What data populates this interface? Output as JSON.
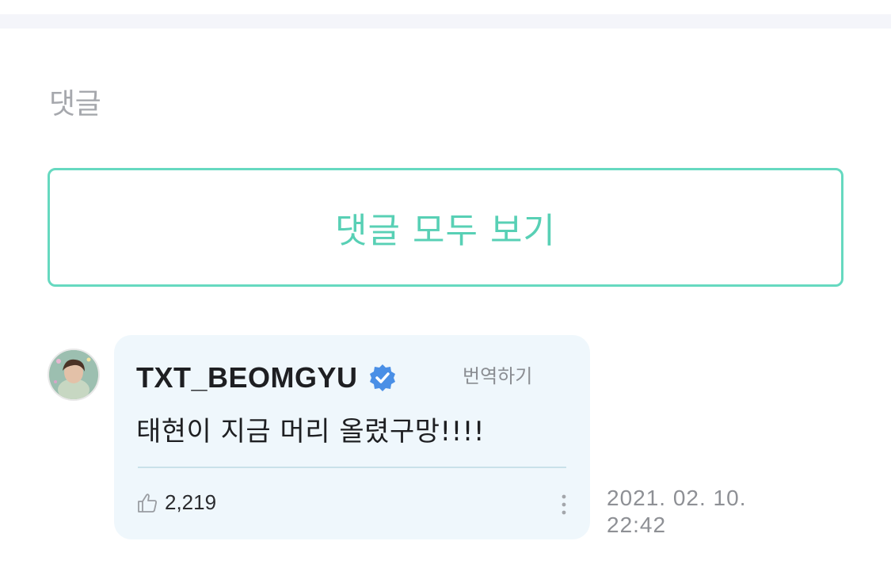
{
  "comments_section": {
    "title": "댓글",
    "view_all_label": "댓글 모두 보기"
  },
  "comment": {
    "author": "TXT_BEOMGYU",
    "verified": true,
    "translate_label": "번역하기",
    "text": "태현이 지금 머리 올렸구망!!!!",
    "likes": "2,219",
    "date": "2021. 02. 10.",
    "time": "22:42"
  },
  "icons": {
    "verified": "verified-badge-icon",
    "like": "thumbs-up-icon",
    "more": "more-vertical-icon"
  },
  "colors": {
    "accent": "#58d0b5",
    "verified": "#4a8fe6",
    "card_bg": "#eff7fc"
  }
}
